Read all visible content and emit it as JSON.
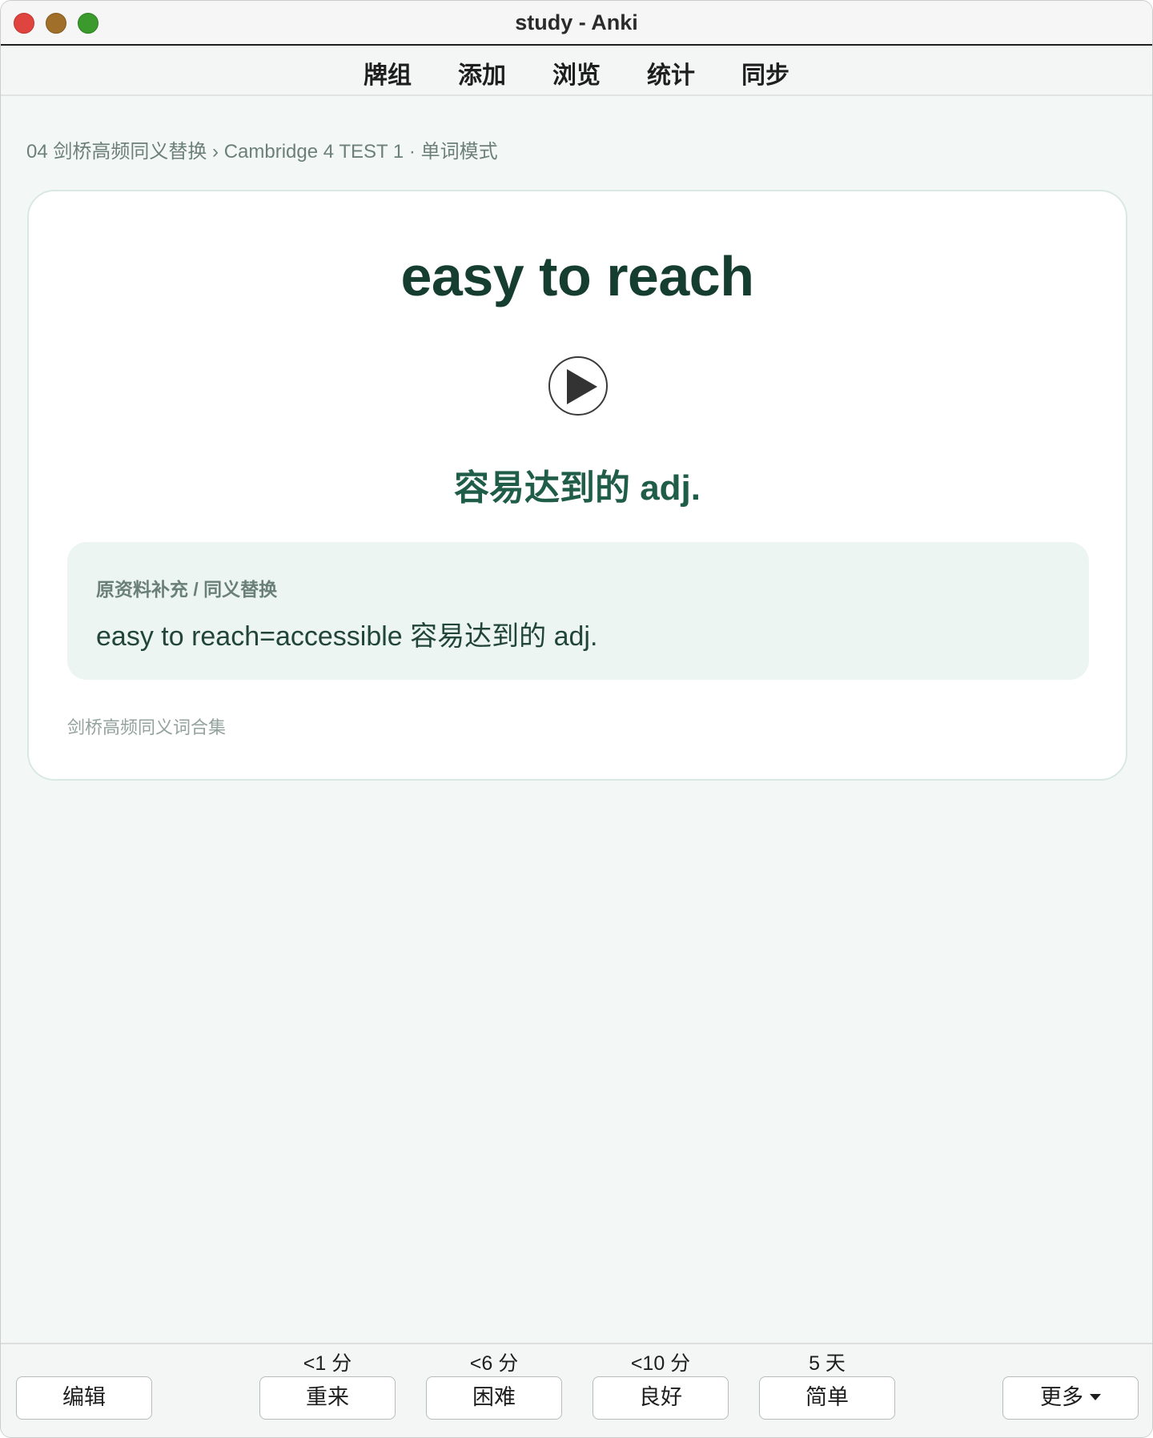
{
  "window": {
    "title": "study - Anki"
  },
  "toolbar": {
    "items": [
      {
        "label": "牌组"
      },
      {
        "label": "添加"
      },
      {
        "label": "浏览"
      },
      {
        "label": "统计"
      },
      {
        "label": "同步"
      }
    ]
  },
  "breadcrumb": {
    "text": "04 剑桥高频同义替换 › Cambridge 4 TEST 1 · 单词模式"
  },
  "card": {
    "word": "easy to reach",
    "audio_icon": "play-icon",
    "meaning": "容易达到的 adj.",
    "note": {
      "label": "原资料补充 / 同义替换",
      "text": "easy to reach=accessible 容易达到的 adj."
    },
    "source": "剑桥高频同义词合集"
  },
  "bottom": {
    "edit_label": "编辑",
    "more_label": "更多",
    "answers": [
      {
        "interval": "<1 分",
        "label": "重来"
      },
      {
        "interval": "<6 分",
        "label": "困难"
      },
      {
        "interval": "<10 分",
        "label": "良好"
      },
      {
        "interval": "5 天",
        "label": "简单"
      }
    ]
  },
  "colors": {
    "accent_dark": "#153d30",
    "accent": "#1f5d48",
    "background": "#f3f8f6"
  }
}
